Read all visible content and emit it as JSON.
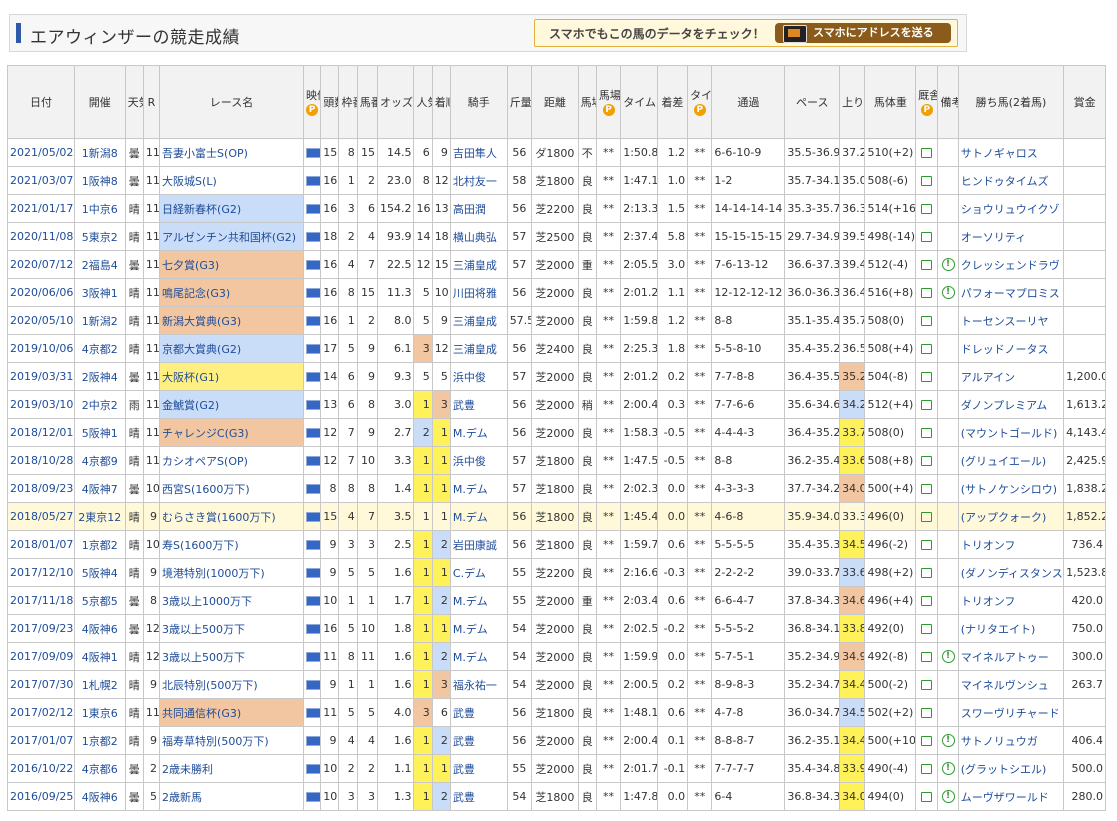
{
  "page": {
    "title": "エアウィンザーの競走成績",
    "promo_text": "スマホでもこの馬のデータをチェック！",
    "promo_button": "スマホにアドレスを送る"
  },
  "columns": [
    "日付",
    "開催",
    "天気",
    "R",
    "レース名",
    "映像",
    "頭数",
    "枠番",
    "馬番",
    "オッズ",
    "人気",
    "着順",
    "騎手",
    "斤量",
    "距離",
    "馬場",
    "馬場指数",
    "タイム",
    "着差",
    "タイム指数",
    "通過",
    "ペース",
    "上り",
    "馬体重",
    "厩舎コメント",
    "備考",
    "勝ち馬(2着馬)",
    "賞金"
  ],
  "header_labels": {
    "date": "日付",
    "venue": "開催",
    "weather": "天気",
    "race_no": "R",
    "race_name": "レース名",
    "video": "映像",
    "heads": "頭数",
    "gate": "枠番",
    "horse_no": "馬番",
    "odds": "オッズ",
    "pop": "人気",
    "place": "着順",
    "jockey": "騎手",
    "weight": "斤量",
    "dist": "距離",
    "track": "馬場",
    "track_idx": "馬場指数",
    "time": "タイム",
    "margin": "着差",
    "time_idx": "タイム指数",
    "passing": "通過",
    "pace": "ペース",
    "agari": "上り",
    "body": "馬体重",
    "comment": "厩舎コメント",
    "note": "備考",
    "winner": "勝ち馬(2着馬)",
    "prize": "賞金",
    "p_mark": "P"
  },
  "rows": [
    {
      "date": "2021/05/02",
      "venue": "1新潟8",
      "weather": "曇",
      "race": "11",
      "name": "吾妻小富士S(OP)",
      "grade": "",
      "heads": "15",
      "gate": "8",
      "no": "15",
      "odds": "14.5",
      "pop": "6",
      "place": "9",
      "jockey": "吉田隼人",
      "kg": "56",
      "dist": "ダ1800",
      "track": "不",
      "tidx": "**",
      "time": "1:50.8",
      "margin": "1.2",
      "tmidx": "**",
      "passing": "6-6-10-9",
      "pace": "35.5-36.9",
      "agari": "37.2",
      "body": "510(+2)",
      "note": "",
      "winner": "サトノギャロス",
      "prize": "",
      "hl": false,
      "agc": ""
    },
    {
      "date": "2021/03/07",
      "venue": "1阪神8",
      "weather": "曇",
      "race": "11",
      "name": "大阪城S(L)",
      "grade": "",
      "heads": "16",
      "gate": "1",
      "no": "2",
      "odds": "23.0",
      "pop": "8",
      "place": "12",
      "jockey": "北村友一",
      "kg": "58",
      "dist": "芝1800",
      "track": "良",
      "tidx": "**",
      "time": "1:47.1",
      "margin": "1.0",
      "tmidx": "**",
      "passing": "1-2",
      "pace": "35.7-34.1",
      "agari": "35.0",
      "body": "508(-6)",
      "note": "",
      "winner": "ヒンドゥタイムズ",
      "prize": "",
      "hl": false,
      "agc": ""
    },
    {
      "date": "2021/01/17",
      "venue": "1中京6",
      "weather": "晴",
      "race": "11",
      "name": "日経新春杯(G2)",
      "grade": "g2",
      "heads": "16",
      "gate": "3",
      "no": "6",
      "odds": "154.2",
      "pop": "16",
      "place": "13",
      "jockey": "高田潤",
      "kg": "56",
      "dist": "芝2200",
      "track": "良",
      "tidx": "**",
      "time": "2:13.3",
      "margin": "1.5",
      "tmidx": "**",
      "passing": "14-14-14-14",
      "pace": "35.3-35.7",
      "agari": "36.3",
      "body": "514(+16)",
      "note": "",
      "winner": "ショウリュウイクゾ",
      "prize": "",
      "hl": false,
      "agc": ""
    },
    {
      "date": "2020/11/08",
      "venue": "5東京2",
      "weather": "晴",
      "race": "11",
      "name": "アルゼンチン共和国杯(G2)",
      "grade": "g2",
      "heads": "18",
      "gate": "2",
      "no": "4",
      "odds": "93.9",
      "pop": "14",
      "place": "18",
      "jockey": "横山典弘",
      "kg": "57",
      "dist": "芝2500",
      "track": "良",
      "tidx": "**",
      "time": "2:37.4",
      "margin": "5.8",
      "tmidx": "**",
      "passing": "15-15-15-15",
      "pace": "29.7-34.9",
      "agari": "39.5",
      "body": "498(-14)",
      "note": "",
      "winner": "オーソリティ",
      "prize": "",
      "hl": false,
      "agc": ""
    },
    {
      "date": "2020/07/12",
      "venue": "2福島4",
      "weather": "曇",
      "race": "11",
      "name": "七夕賞(G3)",
      "grade": "g3",
      "heads": "16",
      "gate": "4",
      "no": "7",
      "odds": "22.5",
      "pop": "12",
      "place": "15",
      "jockey": "三浦皇成",
      "kg": "57",
      "dist": "芝2000",
      "track": "重",
      "tidx": "**",
      "time": "2:05.5",
      "margin": "3.0",
      "tmidx": "**",
      "passing": "7-6-13-12",
      "pace": "36.6-37.3",
      "agari": "39.4",
      "body": "512(-4)",
      "note": "!",
      "winner": "クレッシェンドラヴ",
      "prize": "",
      "hl": false,
      "agc": ""
    },
    {
      "date": "2020/06/06",
      "venue": "3阪神1",
      "weather": "晴",
      "race": "11",
      "name": "鳴尾記念(G3)",
      "grade": "g3",
      "heads": "16",
      "gate": "8",
      "no": "15",
      "odds": "11.3",
      "pop": "5",
      "place": "10",
      "jockey": "川田将雅",
      "kg": "56",
      "dist": "芝2000",
      "track": "良",
      "tidx": "**",
      "time": "2:01.2",
      "margin": "1.1",
      "tmidx": "**",
      "passing": "12-12-12-12",
      "pace": "36.0-36.3",
      "agari": "36.4",
      "body": "516(+8)",
      "note": "!",
      "winner": "パフォーマプロミス",
      "prize": "",
      "hl": false,
      "agc": ""
    },
    {
      "date": "2020/05/10",
      "venue": "1新潟2",
      "weather": "晴",
      "race": "11",
      "name": "新潟大賞典(G3)",
      "grade": "g3",
      "heads": "16",
      "gate": "1",
      "no": "2",
      "odds": "8.0",
      "pop": "5",
      "place": "9",
      "jockey": "三浦皇成",
      "kg": "57.5",
      "dist": "芝2000",
      "track": "良",
      "tidx": "**",
      "time": "1:59.8",
      "margin": "1.2",
      "tmidx": "**",
      "passing": "8-8",
      "pace": "35.1-35.4",
      "agari": "35.7",
      "body": "508(0)",
      "note": "",
      "winner": "トーセンスーリヤ",
      "prize": "",
      "hl": false,
      "agc": ""
    },
    {
      "date": "2019/10/06",
      "venue": "4京都2",
      "weather": "晴",
      "race": "11",
      "name": "京都大賞典(G2)",
      "grade": "g2",
      "heads": "17",
      "gate": "5",
      "no": "9",
      "odds": "6.1",
      "pop": "3",
      "place": "12",
      "jockey": "三浦皇成",
      "kg": "56",
      "dist": "芝2400",
      "track": "良",
      "tidx": "**",
      "time": "2:25.3",
      "margin": "1.8",
      "tmidx": "**",
      "passing": "5-5-8-10",
      "pace": "35.4-35.2",
      "agari": "36.5",
      "body": "508(+4)",
      "note": "",
      "winner": "ドレッドノータス",
      "prize": "",
      "hl": false,
      "agc": ""
    },
    {
      "date": "2019/03/31",
      "venue": "2阪神4",
      "weather": "曇",
      "race": "11",
      "name": "大阪杯(G1)",
      "grade": "g1",
      "heads": "14",
      "gate": "6",
      "no": "9",
      "odds": "9.3",
      "pop": "5",
      "place": "5",
      "jockey": "浜中俊",
      "kg": "57",
      "dist": "芝2000",
      "track": "良",
      "tidx": "**",
      "time": "2:01.2",
      "margin": "0.2",
      "tmidx": "**",
      "passing": "7-7-8-8",
      "pace": "36.4-35.5",
      "agari": "35.2",
      "body": "504(-8)",
      "note": "",
      "winner": "アルアイン",
      "prize": "1,200.0",
      "hl": false,
      "agc": "ag3"
    },
    {
      "date": "2019/03/10",
      "venue": "2中京2",
      "weather": "雨",
      "race": "11",
      "name": "金鯱賞(G2)",
      "grade": "g2",
      "heads": "13",
      "gate": "6",
      "no": "8",
      "odds": "3.0",
      "pop": "1",
      "place": "3",
      "jockey": "武豊",
      "kg": "56",
      "dist": "芝2000",
      "track": "稍",
      "tidx": "**",
      "time": "2:00.4",
      "margin": "0.3",
      "tmidx": "**",
      "passing": "7-7-6-6",
      "pace": "35.6-34.6",
      "agari": "34.2",
      "body": "512(+4)",
      "note": "",
      "winner": "ダノンプレミアム",
      "prize": "1,613.2",
      "hl": false,
      "agc": "ag2"
    },
    {
      "date": "2018/12/01",
      "venue": "5阪神1",
      "weather": "晴",
      "race": "11",
      "name": "チャレンジC(G3)",
      "grade": "g3",
      "heads": "12",
      "gate": "7",
      "no": "9",
      "odds": "2.7",
      "pop": "2",
      "place": "1",
      "jockey": "M.デム",
      "kg": "56",
      "dist": "芝2000",
      "track": "良",
      "tidx": "**",
      "time": "1:58.3",
      "margin": "-0.5",
      "tmidx": "**",
      "passing": "4-4-4-3",
      "pace": "36.4-35.2",
      "agari": "33.7",
      "body": "508(0)",
      "note": "",
      "winner": "(マウントゴールド)",
      "prize": "4,143.4",
      "hl": false,
      "agc": "ag1"
    },
    {
      "date": "2018/10/28",
      "venue": "4京都9",
      "weather": "晴",
      "race": "11",
      "name": "カシオペアS(OP)",
      "grade": "",
      "heads": "12",
      "gate": "7",
      "no": "10",
      "odds": "3.3",
      "pop": "1",
      "place": "1",
      "jockey": "浜中俊",
      "kg": "57",
      "dist": "芝1800",
      "track": "良",
      "tidx": "**",
      "time": "1:47.5",
      "margin": "-0.5",
      "tmidx": "**",
      "passing": "8-8",
      "pace": "36.2-35.4",
      "agari": "33.6",
      "body": "508(+8)",
      "note": "",
      "winner": "(グリュイエール)",
      "prize": "2,425.9",
      "hl": false,
      "agc": "ag1"
    },
    {
      "date": "2018/09/23",
      "venue": "4阪神7",
      "weather": "曇",
      "race": "10",
      "name": "西宮S(1600万下)",
      "grade": "",
      "heads": "8",
      "gate": "8",
      "no": "8",
      "odds": "1.4",
      "pop": "1",
      "place": "1",
      "jockey": "M.デム",
      "kg": "57",
      "dist": "芝1800",
      "track": "良",
      "tidx": "**",
      "time": "2:02.3",
      "margin": "0.0",
      "tmidx": "**",
      "passing": "4-3-3-3",
      "pace": "37.7-34.2",
      "agari": "34.0",
      "body": "500(+4)",
      "note": "",
      "winner": "(サトノケンシロウ)",
      "prize": "1,838.2",
      "hl": false,
      "agc": "ag3"
    },
    {
      "date": "2018/05/27",
      "venue": "2東京12",
      "weather": "晴",
      "race": "9",
      "name": "むらさき賞(1600万下)",
      "grade": "",
      "heads": "15",
      "gate": "4",
      "no": "7",
      "odds": "3.5",
      "pop": "1",
      "place": "1",
      "jockey": "M.デム",
      "kg": "56",
      "dist": "芝1800",
      "track": "良",
      "tidx": "**",
      "time": "1:45.4",
      "margin": "0.0",
      "tmidx": "**",
      "passing": "4-6-8",
      "pace": "35.9-34.0",
      "agari": "33.3",
      "body": "496(0)",
      "note": "",
      "winner": "(アップクォーク)",
      "prize": "1,852.2",
      "hl": true,
      "agc": "ag2"
    },
    {
      "date": "2018/01/07",
      "venue": "1京都2",
      "weather": "晴",
      "race": "10",
      "name": "寿S(1600万下)",
      "grade": "",
      "heads": "9",
      "gate": "3",
      "no": "3",
      "odds": "2.5",
      "pop": "1",
      "place": "2",
      "jockey": "岩田康誠",
      "kg": "56",
      "dist": "芝1800",
      "track": "良",
      "tidx": "**",
      "time": "1:59.7",
      "margin": "0.6",
      "tmidx": "**",
      "passing": "5-5-5-5",
      "pace": "35.4-35.3",
      "agari": "34.5",
      "body": "496(-2)",
      "note": "",
      "winner": "トリオンフ",
      "prize": "736.4",
      "hl": false,
      "agc": "ag1"
    },
    {
      "date": "2017/12/10",
      "venue": "5阪神4",
      "weather": "晴",
      "race": "9",
      "name": "境港特別(1000万下)",
      "grade": "",
      "heads": "9",
      "gate": "5",
      "no": "5",
      "odds": "1.6",
      "pop": "1",
      "place": "1",
      "jockey": "C.デム",
      "kg": "55",
      "dist": "芝2200",
      "track": "良",
      "tidx": "**",
      "time": "2:16.6",
      "margin": "-0.3",
      "tmidx": "**",
      "passing": "2-2-2-2",
      "pace": "39.0-33.7",
      "agari": "33.6",
      "body": "498(+2)",
      "note": "",
      "winner": "(ダノンディスタンス)",
      "prize": "1,523.8",
      "hl": false,
      "agc": "ag2"
    },
    {
      "date": "2017/11/18",
      "venue": "5京都5",
      "weather": "曇",
      "race": "8",
      "name": "3歳以上1000万下",
      "grade": "",
      "heads": "10",
      "gate": "1",
      "no": "1",
      "odds": "1.7",
      "pop": "1",
      "place": "2",
      "jockey": "M.デム",
      "kg": "55",
      "dist": "芝2000",
      "track": "重",
      "tidx": "**",
      "time": "2:03.4",
      "margin": "0.6",
      "tmidx": "**",
      "passing": "6-6-4-7",
      "pace": "37.8-34.3",
      "agari": "34.6",
      "body": "496(+4)",
      "note": "",
      "winner": "トリオンフ",
      "prize": "420.0",
      "hl": false,
      "agc": "ag3"
    },
    {
      "date": "2017/09/23",
      "venue": "4阪神6",
      "weather": "曇",
      "race": "12",
      "name": "3歳以上500万下",
      "grade": "",
      "heads": "16",
      "gate": "5",
      "no": "10",
      "odds": "1.8",
      "pop": "1",
      "place": "1",
      "jockey": "M.デム",
      "kg": "54",
      "dist": "芝2000",
      "track": "良",
      "tidx": "**",
      "time": "2:02.5",
      "margin": "-0.2",
      "tmidx": "**",
      "passing": "5-5-5-2",
      "pace": "36.8-34.1",
      "agari": "33.8",
      "body": "492(0)",
      "note": "",
      "winner": "(ナリタエイト)",
      "prize": "750.0",
      "hl": false,
      "agc": "ag1"
    },
    {
      "date": "2017/09/09",
      "venue": "4阪神1",
      "weather": "晴",
      "race": "12",
      "name": "3歳以上500万下",
      "grade": "",
      "heads": "11",
      "gate": "8",
      "no": "11",
      "odds": "1.6",
      "pop": "1",
      "place": "2",
      "jockey": "M.デム",
      "kg": "54",
      "dist": "芝2000",
      "track": "良",
      "tidx": "**",
      "time": "1:59.9",
      "margin": "0.0",
      "tmidx": "**",
      "passing": "5-7-5-1",
      "pace": "35.2-34.9",
      "agari": "34.9",
      "body": "492(-8)",
      "note": "!",
      "winner": "マイネルアトゥー",
      "prize": "300.0",
      "hl": false,
      "agc": "ag3"
    },
    {
      "date": "2017/07/30",
      "venue": "1札幌2",
      "weather": "晴",
      "race": "9",
      "name": "北辰特別(500万下)",
      "grade": "",
      "heads": "9",
      "gate": "1",
      "no": "1",
      "odds": "1.6",
      "pop": "1",
      "place": "3",
      "jockey": "福永祐一",
      "kg": "54",
      "dist": "芝2000",
      "track": "良",
      "tidx": "**",
      "time": "2:00.5",
      "margin": "0.2",
      "tmidx": "**",
      "passing": "8-9-8-3",
      "pace": "35.2-34.7",
      "agari": "34.4",
      "body": "500(-2)",
      "note": "",
      "winner": "マイネルヴンシュ",
      "prize": "263.7",
      "hl": false,
      "agc": "ag1"
    },
    {
      "date": "2017/02/12",
      "venue": "1東京6",
      "weather": "晴",
      "race": "11",
      "name": "共同通信杯(G3)",
      "grade": "g3",
      "heads": "11",
      "gate": "5",
      "no": "5",
      "odds": "4.0",
      "pop": "3",
      "place": "6",
      "jockey": "武豊",
      "kg": "56",
      "dist": "芝1800",
      "track": "良",
      "tidx": "**",
      "time": "1:48.1",
      "margin": "0.6",
      "tmidx": "**",
      "passing": "4-7-8",
      "pace": "36.0-34.7",
      "agari": "34.5",
      "body": "502(+2)",
      "note": "",
      "winner": "スワーヴリチャード",
      "prize": "",
      "hl": false,
      "agc": "ag2"
    },
    {
      "date": "2017/01/07",
      "venue": "1京都2",
      "weather": "晴",
      "race": "9",
      "name": "福寿草特別(500万下)",
      "grade": "",
      "heads": "9",
      "gate": "4",
      "no": "4",
      "odds": "1.6",
      "pop": "1",
      "place": "2",
      "jockey": "武豊",
      "kg": "56",
      "dist": "芝2000",
      "track": "良",
      "tidx": "**",
      "time": "2:00.4",
      "margin": "0.1",
      "tmidx": "**",
      "passing": "8-8-8-7",
      "pace": "36.2-35.1",
      "agari": "34.4",
      "body": "500(+10)",
      "note": "!",
      "winner": "サトノリュウガ",
      "prize": "406.4",
      "hl": false,
      "agc": "ag1"
    },
    {
      "date": "2016/10/22",
      "venue": "4京都6",
      "weather": "曇",
      "race": "2",
      "name": "2歳未勝利",
      "grade": "",
      "heads": "10",
      "gate": "2",
      "no": "2",
      "odds": "1.1",
      "pop": "1",
      "place": "1",
      "jockey": "武豊",
      "kg": "55",
      "dist": "芝2000",
      "track": "良",
      "tidx": "**",
      "time": "2:01.7",
      "margin": "-0.1",
      "tmidx": "**",
      "passing": "7-7-7-7",
      "pace": "35.4-34.8",
      "agari": "33.9",
      "body": "490(-4)",
      "note": "!",
      "winner": "(グラットシエル)",
      "prize": "500.0",
      "hl": false,
      "agc": "ag1"
    },
    {
      "date": "2016/09/25",
      "venue": "4阪神6",
      "weather": "曇",
      "race": "5",
      "name": "2歳新馬",
      "grade": "",
      "heads": "10",
      "gate": "3",
      "no": "3",
      "odds": "1.3",
      "pop": "1",
      "place": "2",
      "jockey": "武豊",
      "kg": "54",
      "dist": "芝1800",
      "track": "良",
      "tidx": "**",
      "time": "1:47.8",
      "margin": "0.0",
      "tmidx": "**",
      "passing": "6-4",
      "pace": "36.8-34.3",
      "agari": "34.0",
      "body": "494(0)",
      "note": "!",
      "winner": "ムーヴザワールド",
      "prize": "280.0",
      "hl": false,
      "agc": "ag1"
    }
  ]
}
